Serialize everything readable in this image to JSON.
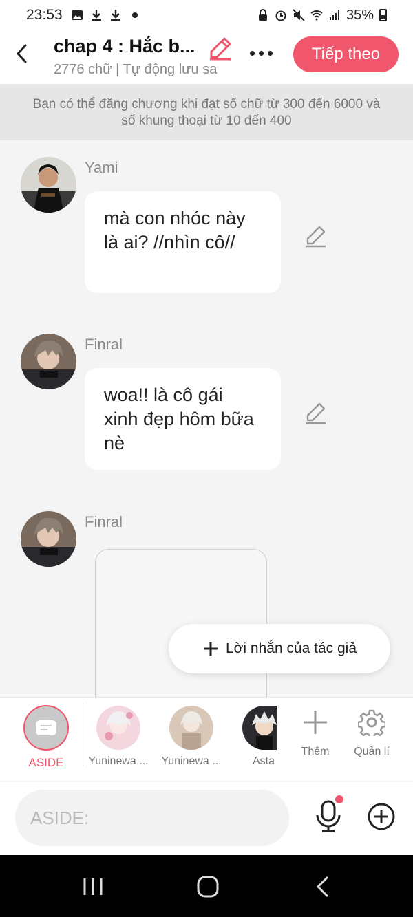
{
  "status_bar": {
    "time": "23:53",
    "battery": "35%"
  },
  "header": {
    "title": "chap 4 : Hắc b...",
    "subtitle": "2776 chữ | Tự động lưu sa",
    "next_label": "Tiếp theo"
  },
  "notice": {
    "text": "Bạn có thể đăng chương khi đạt số chữ từ 300 đến 6000 và số khung thoại từ 10 đến 400"
  },
  "messages": [
    {
      "sender": "Yami",
      "text": "mà con nhóc này là ai? //nhìn cô//"
    },
    {
      "sender": "Finral",
      "text": "woa!! là cô gái xinh đẹp hôm bữa nè"
    },
    {
      "sender": "Finral",
      "text": ""
    }
  ],
  "author_note": {
    "label": "Lời nhắn của tác giả"
  },
  "characters": {
    "aside_label": "ASIDE",
    "items": [
      {
        "name": "Yuninewa ..."
      },
      {
        "name": "Yuninewa ..."
      },
      {
        "name": "Asta"
      }
    ],
    "add_label": "Thêm",
    "manage_label": "Quản lí"
  },
  "composer": {
    "placeholder": "ASIDE:"
  },
  "colors": {
    "accent": "#f0566c",
    "background": "#f4f4f4"
  }
}
